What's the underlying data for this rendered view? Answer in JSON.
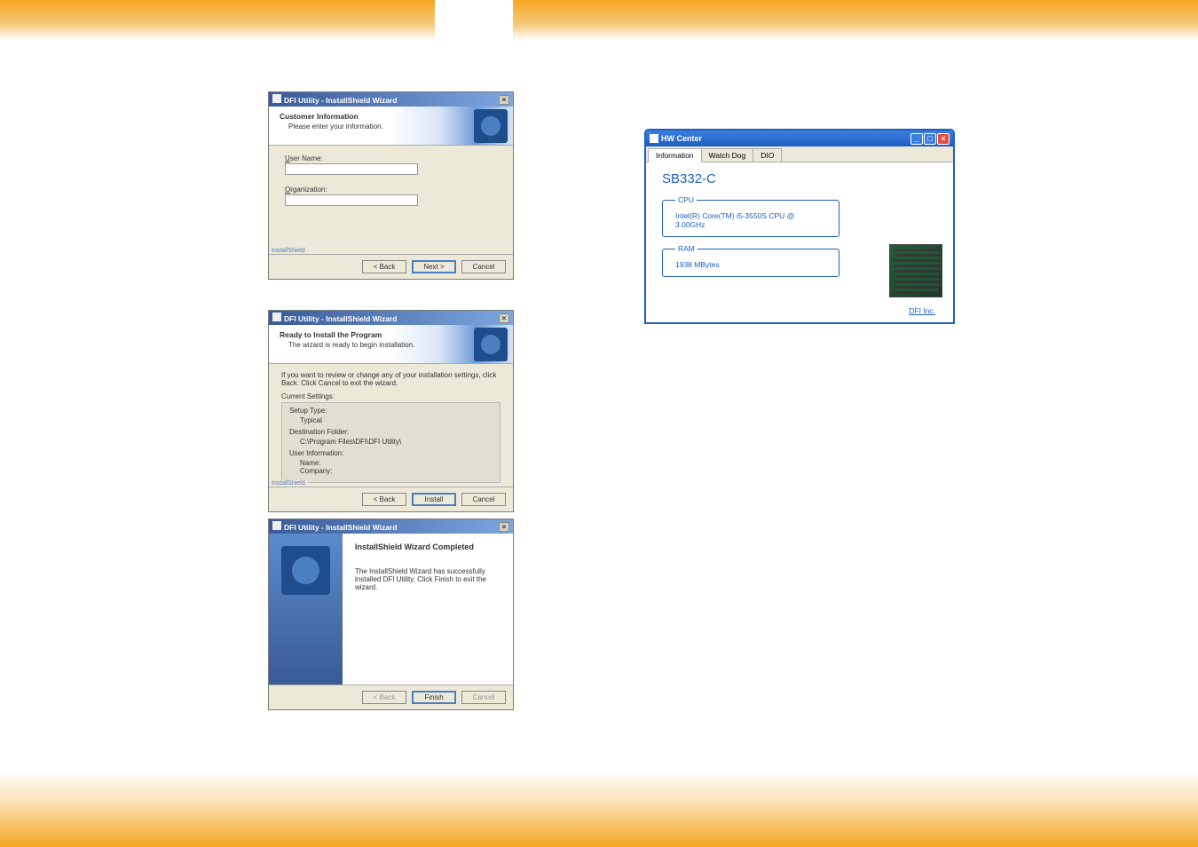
{
  "dialog1": {
    "title": "DFI Utility - InstallShield Wizard",
    "header_title": "Customer Information",
    "header_sub": "Please enter your information.",
    "username_label": "User Name:",
    "username_value": "",
    "org_label": "Organization:",
    "org_value": "",
    "footer_label": "InstallShield",
    "back": "< Back",
    "next": "Next >",
    "cancel": "Cancel"
  },
  "dialog2": {
    "title": "DFI Utility - InstallShield Wizard",
    "header_title": "Ready to Install the Program",
    "header_sub": "The wizard is ready to begin installation.",
    "intro": "If you want to review or change any of your installation settings, click Back. Click Cancel to exit the wizard.",
    "current_settings": "Current Settings:",
    "setup_type_label": "Setup Type:",
    "setup_type": "Typical",
    "dest_label": "Destination Folder:",
    "dest": "C:\\Program Files\\DFI\\DFI Utility\\",
    "userinfo_label": "User Information:",
    "userinfo_name": "Name:",
    "userinfo_company": "Company:",
    "footer_label": "InstallShield",
    "back": "< Back",
    "install": "Install",
    "cancel": "Cancel"
  },
  "dialog3": {
    "title": "DFI Utility - InstallShield Wizard",
    "done_title": "InstallShield Wizard Completed",
    "done_text": "The InstallShield Wizard has successfully installed DFI Utility. Click Finish to exit the wizard.",
    "back": "< Back",
    "finish": "Finish",
    "cancel": "Cancel"
  },
  "hwcenter": {
    "title": "HW Center",
    "tab_info": "Information",
    "tab_wdt": "Watch Dog",
    "tab_dio": "DIO",
    "product": "SB332-C",
    "cpu_legend": "CPU",
    "cpu_value": "Intel(R) Core(TM) i5-3550S CPU @ 3.00GHz",
    "ram_legend": "RAM",
    "ram_value": "1938 MBytes",
    "link": "DFI Inc."
  }
}
